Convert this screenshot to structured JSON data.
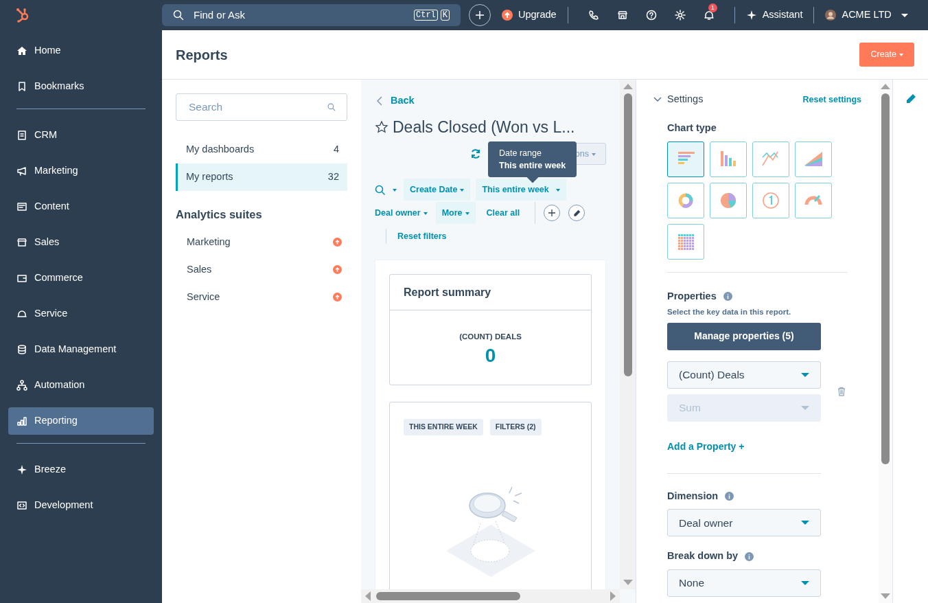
{
  "topbar": {
    "search": {
      "placeholder": "Find or Ask",
      "keys": [
        "Ctrl",
        "K"
      ]
    },
    "upgrade": "Upgrade",
    "notifications": "1",
    "assistant": "Assistant",
    "account": "ACME LTD"
  },
  "sidebar": {
    "groups": [
      {
        "items": [
          {
            "label": "Home",
            "selected": false
          },
          {
            "label": "Bookmarks",
            "selected": false
          }
        ]
      },
      {
        "items": [
          {
            "label": "CRM",
            "selected": false
          },
          {
            "label": "Marketing",
            "selected": false
          },
          {
            "label": "Content",
            "selected": false
          },
          {
            "label": "Sales",
            "selected": false
          },
          {
            "label": "Commerce",
            "selected": false
          },
          {
            "label": "Service",
            "selected": false
          },
          {
            "label": "Data Management",
            "selected": false
          },
          {
            "label": "Automation",
            "selected": false
          },
          {
            "label": "Reporting",
            "selected": true
          }
        ]
      },
      {
        "items": [
          {
            "label": "Breeze",
            "selected": false
          },
          {
            "label": "Development",
            "selected": false
          }
        ]
      }
    ]
  },
  "page": {
    "title": "Reports",
    "create_button": "Create"
  },
  "left_panel": {
    "search": {
      "placeholder": "Search"
    },
    "nav": [
      {
        "label": "My dashboards",
        "count": "4",
        "selected": false
      },
      {
        "label": "My reports",
        "count": "32",
        "selected": true
      }
    ],
    "suites_heading": "Analytics suites",
    "suites": [
      {
        "label": "Marketing",
        "upgrade": true
      },
      {
        "label": "Sales",
        "upgrade": true
      },
      {
        "label": "Service",
        "upgrade": true
      }
    ]
  },
  "report": {
    "back": "Back",
    "title": "Deals Closed (Won vs L...",
    "starred": false,
    "actions": "ons",
    "tooltip": {
      "title": "Date range",
      "value": "This entire week"
    },
    "filters": [
      {
        "label": "Create Date",
        "kind": "chip"
      },
      {
        "label": "This entire week",
        "kind": "chip"
      },
      {
        "label": "Deal owner",
        "kind": "link"
      },
      {
        "label": "More",
        "kind": "chip"
      }
    ],
    "clear_all": "Clear all",
    "reset_filters": "Reset filters",
    "summary": {
      "title": "Report summary",
      "metric_label": "(COUNT) DEALS",
      "metric_value": "0"
    },
    "tags": [
      "THIS ENTIRE WEEK",
      "FILTERS (2)"
    ]
  },
  "settings": {
    "heading": "Settings",
    "expanded": true,
    "reset": "Reset settings",
    "chart_type_label": "Chart type",
    "chart_types": [
      {
        "kind": "hbar",
        "selected": true
      },
      {
        "kind": "column",
        "selected": false
      },
      {
        "kind": "line",
        "selected": false
      },
      {
        "kind": "area",
        "selected": false
      },
      {
        "kind": "donut",
        "selected": false
      },
      {
        "kind": "pie",
        "selected": false
      },
      {
        "kind": "number",
        "selected": false
      },
      {
        "kind": "gauge",
        "selected": false
      },
      {
        "kind": "table",
        "selected": false
      }
    ],
    "properties": {
      "label": "Properties",
      "hint": "Select the key data in this report.",
      "manage_button": "Manage properties (5)",
      "fields": [
        {
          "value": "(Count) Deals",
          "disabled": false
        },
        {
          "value": "Sum",
          "disabled": true
        }
      ],
      "add": "Add a Property +"
    },
    "dimension": {
      "label": "Dimension",
      "value": "Deal owner"
    },
    "breakdown": {
      "label": "Break down by",
      "value": "None"
    }
  }
}
